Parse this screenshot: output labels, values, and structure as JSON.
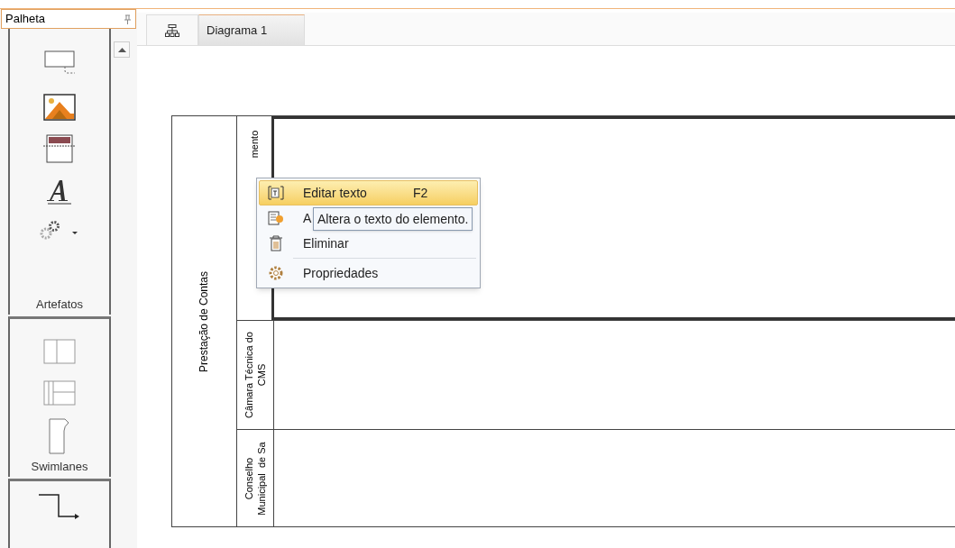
{
  "palette": {
    "title": "Palheta",
    "groups": [
      {
        "label": "Artefatos",
        "tools": [
          {
            "kind": "annotation"
          },
          {
            "kind": "image"
          },
          {
            "kind": "header"
          },
          {
            "kind": "text"
          },
          {
            "kind": "gears"
          }
        ]
      },
      {
        "label": "Swimlanes",
        "tools": [
          {
            "kind": "vlanes"
          },
          {
            "kind": "grid"
          },
          {
            "kind": "page"
          }
        ]
      },
      {
        "tools": [
          {
            "kind": "connector"
          }
        ]
      }
    ]
  },
  "tabs": [
    {
      "kind": "icon",
      "selected": false
    },
    {
      "kind": "label",
      "label": "Diagrama 1",
      "selected": true
    }
  ],
  "diagram": {
    "pool": {
      "label": "Prestação de Contas"
    },
    "lanes": [
      {
        "label_lines": [
          "mento"
        ],
        "selected": true
      },
      {
        "label_lines": [
          "Câmara Técnica do",
          "CMS"
        ],
        "selected": false
      },
      {
        "label_lines": [
          "Conselho",
          "Municipal  de Sa"
        ],
        "selected": false
      }
    ]
  },
  "context_menu": {
    "items": [
      {
        "kind": "edit",
        "label": "Editar texto",
        "shortcut": "F2",
        "selected": true
      },
      {
        "kind": "attach",
        "label": "A",
        "selected": false
      },
      {
        "kind": "delete",
        "label": "Eliminar",
        "selected": false
      },
      {
        "kind": "separator"
      },
      {
        "kind": "properties",
        "label": "Propriedades",
        "selected": false
      }
    ]
  },
  "tooltip": {
    "text": "Altera o texto do elemento."
  }
}
